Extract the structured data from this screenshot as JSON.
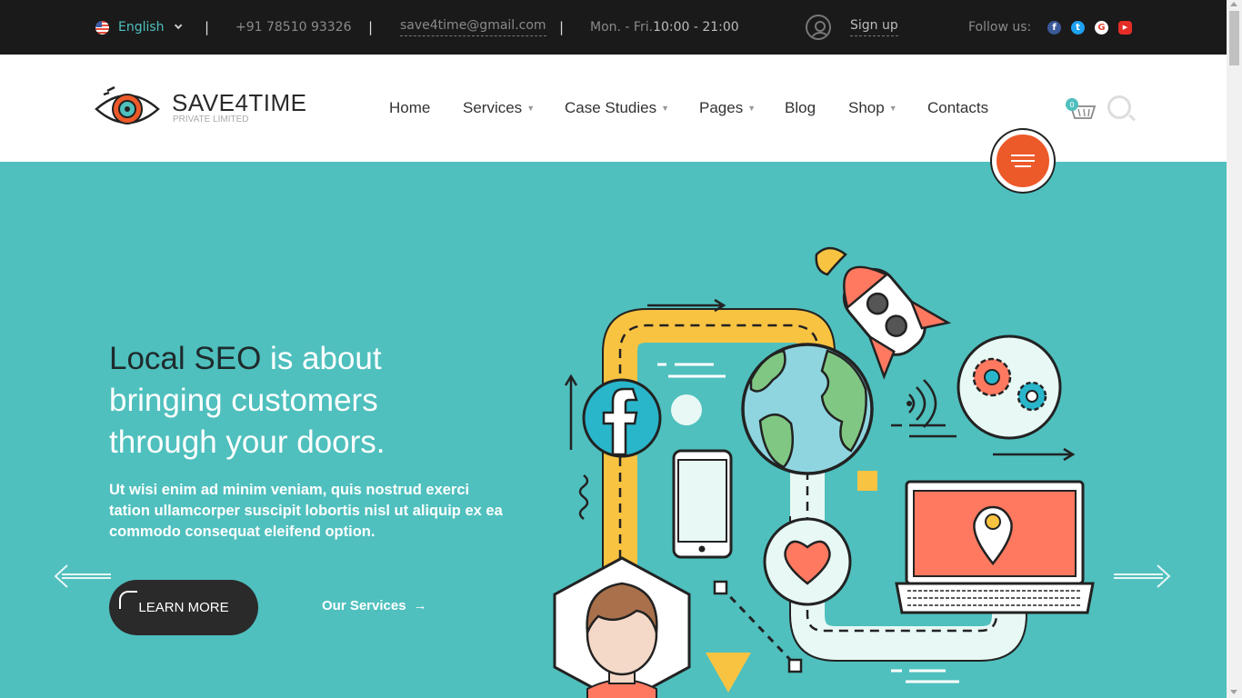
{
  "topbar": {
    "language": "English",
    "separator": "|",
    "phone": "+91 78510 93326",
    "email": "save4time@gmail.com",
    "hours_label": "Mon. - Fri.",
    "hours_value": "10:00 - 21:00",
    "signup": "Sign up",
    "follow": "Follow us:",
    "social": [
      {
        "icon": "facebook-icon",
        "glyph": "f",
        "color": "#3b5998"
      },
      {
        "icon": "twitter-icon",
        "glyph": "t",
        "color": "#1da1f2"
      },
      {
        "icon": "google-icon",
        "glyph": "G",
        "color": "#ea4335"
      },
      {
        "icon": "youtube-icon",
        "glyph": "▶",
        "color": "#e52d27"
      }
    ]
  },
  "header": {
    "brand": "SAVE4TIME",
    "brand_sub": "PRIVATE LIMITED",
    "nav": [
      {
        "label": "Home",
        "dropdown": false
      },
      {
        "label": "Services",
        "dropdown": true
      },
      {
        "label": "Case Studies",
        "dropdown": true
      },
      {
        "label": "Pages",
        "dropdown": true
      },
      {
        "label": "Blog",
        "dropdown": false
      },
      {
        "label": "Shop",
        "dropdown": true
      },
      {
        "label": "Contacts",
        "dropdown": false
      }
    ],
    "cart_count": "0"
  },
  "hero": {
    "title_dark": "Local SEO",
    "title_light_1": " is about",
    "title_line2": "bringing customers",
    "title_line3": "through your doors.",
    "text": "Ut wisi enim ad minim veniam, quis nostrud exerci tation ullamcorper suscipit lobortis nisl ut aliquip ex ea commodo consequat eleifend option.",
    "button": "LEARN MORE",
    "link": "Our Services",
    "link_arrow": "→"
  },
  "colors": {
    "accent": "#4fc0be",
    "orange": "#ed5a2a",
    "dark": "#1a1a1a"
  }
}
